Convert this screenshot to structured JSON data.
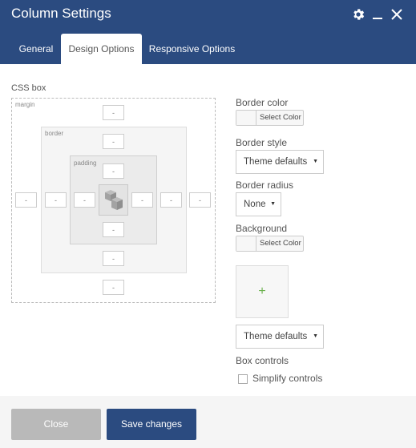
{
  "window": {
    "title": "Column Settings",
    "header_color": "#2b4b80",
    "icons": [
      "gear-icon",
      "minimize-icon",
      "close-icon"
    ]
  },
  "tabs": [
    {
      "label": "General",
      "active": false
    },
    {
      "label": "Design Options",
      "active": true
    },
    {
      "label": "Responsive Options",
      "active": false
    }
  ],
  "css_box": {
    "label": "CSS box",
    "margin_label": "margin",
    "border_label": "border",
    "padding_label": "padding",
    "margin": {
      "top": "-",
      "right": "-",
      "bottom": "-",
      "left": "-"
    },
    "border": {
      "top": "-",
      "right": "-",
      "bottom": "-",
      "left": "-"
    },
    "padding": {
      "top": "-",
      "right": "-",
      "bottom": "-",
      "left": "-"
    }
  },
  "options": {
    "border_color_label": "Border color",
    "border_color_button": "Select Color",
    "border_style_label": "Border style",
    "border_style_value": "Theme defaults",
    "border_radius_label": "Border radius",
    "border_radius_value": "None",
    "background_label": "Background",
    "background_button": "Select Color",
    "add_image_symbol": "+",
    "background_style_value": "Theme defaults",
    "box_controls_label": "Box controls",
    "simplify_label": "Simplify controls",
    "simplify_checked": false,
    "accent_color": "#6ab04c"
  },
  "footer": {
    "close_label": "Close",
    "save_label": "Save changes",
    "save_color": "#2b4b80",
    "close_color": "#b9b9b9"
  }
}
